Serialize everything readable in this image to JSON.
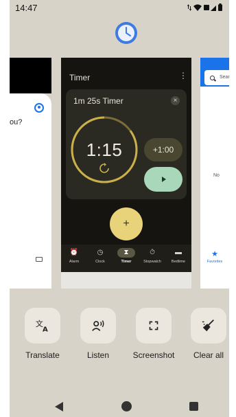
{
  "status_bar": {
    "time": "14:47",
    "icons": [
      "data-arrows-icon",
      "wifi-icon",
      "signal-icon",
      "battery-icon"
    ]
  },
  "app_icon": "clock-app-icon",
  "left_card": {
    "partial_text": "ou?"
  },
  "timer_card": {
    "title": "Timer",
    "menu_glyph": "⋮",
    "panel_title": "1m 25s Timer",
    "close_glyph": "×",
    "time": "1:15",
    "progress_fraction": 0.15,
    "add_minute_label": "+1:00",
    "fab_glyph": "+",
    "nav": [
      {
        "label": "Alarm",
        "glyph": "⏰",
        "active": false
      },
      {
        "label": "Clock",
        "glyph": "◷",
        "active": false
      },
      {
        "label": "Timer",
        "glyph": "⧗",
        "active": true
      },
      {
        "label": "Stopwatch",
        "glyph": "⏱",
        "active": false
      },
      {
        "label": "Bedtime",
        "glyph": "▬",
        "active": false
      }
    ]
  },
  "right_card": {
    "search_placeholder": "Sear",
    "partial_text": "No",
    "fav_label": "Favorites",
    "fav_glyph": "★"
  },
  "actions": [
    {
      "label": "Translate",
      "icon": "translate-icon"
    },
    {
      "label": "Listen",
      "icon": "listen-icon"
    },
    {
      "label": "Screenshot",
      "icon": "screenshot-icon"
    },
    {
      "label": "Clear all",
      "icon": "clear-all-icon"
    }
  ],
  "colors": {
    "screen_bg": "#d8d3c8",
    "timer_bg": "#151411",
    "accent_gold": "#c9b04b",
    "play_green": "#a8d8b9",
    "fab_yellow": "#e8d27a",
    "blue": "#1a73e8"
  }
}
